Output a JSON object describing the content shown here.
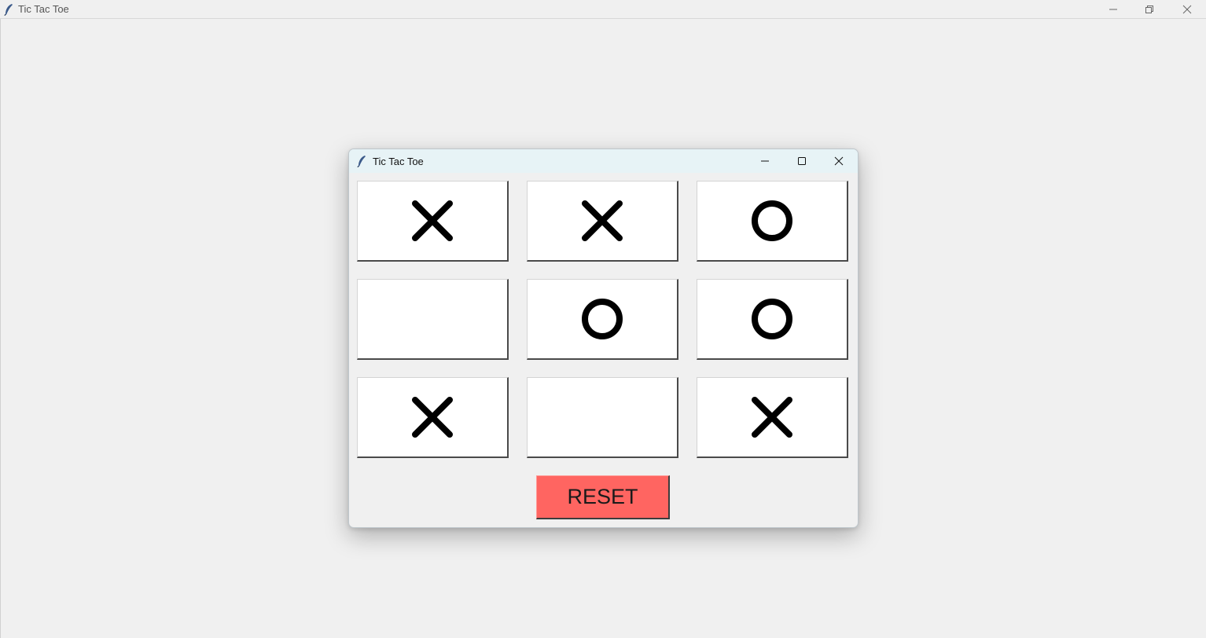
{
  "main_window": {
    "title": "Tic Tac Toe",
    "controls": [
      "minimize-icon",
      "restore-icon",
      "close-icon"
    ]
  },
  "dialog": {
    "title": "Tic Tac Toe",
    "controls": [
      "minimize-icon",
      "maximize-icon",
      "close-icon"
    ],
    "board": [
      [
        "X",
        "X",
        "O"
      ],
      [
        "",
        "O",
        "O"
      ],
      [
        "X",
        "",
        "X"
      ]
    ],
    "reset_label": "RESET",
    "colors": {
      "reset_button": "#ff6561",
      "cell_background": "#ffffff",
      "window_background": "#f0f0f0",
      "dialog_titlebar": "#e7f3f6"
    }
  }
}
